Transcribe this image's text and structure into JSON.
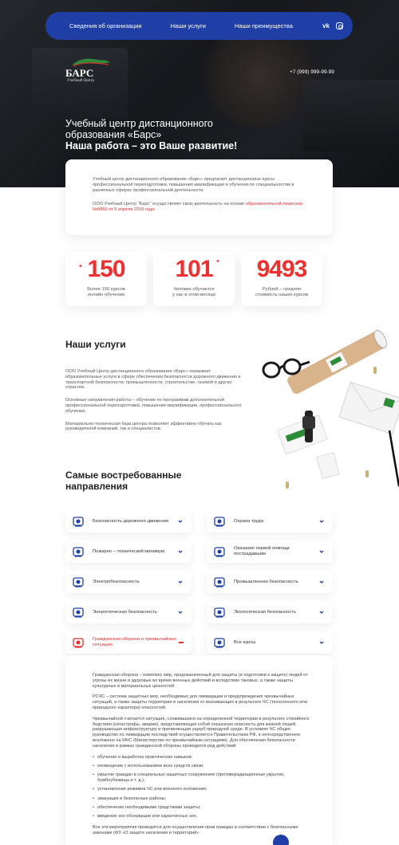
{
  "nav": {
    "items": [
      "Сведения об организации",
      "Наши услуги",
      "Наши преимущества"
    ],
    "social_vk": "vk"
  },
  "logo": {
    "brand": "БАРС",
    "sub": "Учебный Центр"
  },
  "phone": "+7 (999) 999-99-99",
  "hero": {
    "line1": "Учебный центр дистанционного",
    "line2": "образования «Барс»",
    "line3": "Наша работа – это Ваше развитие!"
  },
  "intro": {
    "p1": "Учебный центр дистанционного образования «Барс» предлагает дистанционные курсы профессиональной переподготовки, повышения квалификации и обучения по специальностям в различных сферах профессиональной деятельности.",
    "p2_prefix": "ООО Учебный Центр \"Барс\" осуществляет свою деятельность на основе",
    "p2_link": "образовательной лицензии №9959 от 9 апреля 2018 года"
  },
  "stats": [
    {
      "value": "150",
      "caption1": "Более 150 курсов",
      "caption2": "онлайн обучения"
    },
    {
      "value": "101",
      "caption1": "Человек обучается",
      "caption2": "у нас в этом месяце"
    },
    {
      "value": "9493",
      "caption1": "Рублей – средняя",
      "caption2": "стоимость наших курсов"
    }
  ],
  "services": {
    "title_plain": "Наши",
    "title_bold": "услуги",
    "p1": "ООО Учебный Центр дистанционного образования «Барс» оказывает образовательные услуги в сфере обеспечения безопасности дорожного движения и транспортной безопасности; промышленности, строительстве, газовой и других отраслях.",
    "p2": "Основные направления работы – обучение по программам дополнительной профессиональной переподготовки, повышения квалификации, профессионального обучения.",
    "p3": "Материально-техническая база центра позволяет эффективно обучать как руководителей компаний, так и специалистов."
  },
  "directions": {
    "title_plain": "Самые востребованные",
    "title_bold": "направления",
    "items": [
      {
        "label": "Безопасность дорожного движения",
        "icon": "traffic-light-icon"
      },
      {
        "label": "Охрана труда",
        "icon": "worker-icon"
      },
      {
        "label": "Пожарно – технический минимум",
        "icon": "fire-truck-icon"
      },
      {
        "label": "Оказание первой помощи пострадавшим",
        "icon": "first-aid-icon"
      },
      {
        "label": "Электробезопасность",
        "icon": "electricity-icon"
      },
      {
        "label": "Промышленная безопасность",
        "icon": "factory-icon"
      },
      {
        "label": "Энергетическая безопасность",
        "icon": "power-plant-icon"
      },
      {
        "label": "Экологическая безопасность",
        "icon": "eco-icon"
      },
      {
        "label": "Гражданская оборона и чрезвычайные ситуации",
        "icon": "civil-defense-icon",
        "active": true
      },
      {
        "label": "Все курсы",
        "icon": "all-courses-icon"
      }
    ]
  },
  "detail": {
    "p1": "Гражданская оборона – комплекс мер, предназначенный для защиты (и подготовки к защите) людей от угрозы их жизни и здоровью во время военных действий и вследствие таковых, а также защиты культурных и материальных ценностей.",
    "p2": "РСЧС – система защитных мер, необходимых для ликвидации и предупреждения чрезвычайных ситуаций, а также защиты территории и населения от возникающих в результате ЧС (техногенного или природного характера) опасностей.",
    "p3": "Чрезвычайной считается ситуация, сложившаяся на определенной территории в результате стихийного бедствия (катастрофы, аварии), представляющая собой серьезную опасность для жизней людей, разрушающая инфраструктуру и причиняющая ущерб природной среде. В условиях ЧС общее руководство по ликвидации последствий осуществляется Правительством РФ, а непосредственное возложено на МЧС (Министерство по чрезвычайным ситуациям). Для обеспечения безопасности населения в рамках гражданской обороны проводится ряд действий:",
    "list": [
      "обучение и выработка практических навыков;",
      "оповещение с использованием всех средств связи;",
      "укрытие граждан в специальных защитных сооружениях (противорадиационные укрытия, бомбоубежища и т. д.);",
      "установление режимов ЧС или военного положения;",
      "эвакуация в безопасные районы;",
      "обеспечение необходимыми средствами защиты;",
      "введение зон обсервации или карантинных зон."
    ],
    "p4": "Все эти мероприятия проводятся для осуществления прав граждан в соответствии с безопасными законами (ФЗ «О защите населения и территорий»"
  },
  "colors": {
    "brand_blue": "#1f3fa6",
    "accent_red": "#ee2f2f"
  }
}
